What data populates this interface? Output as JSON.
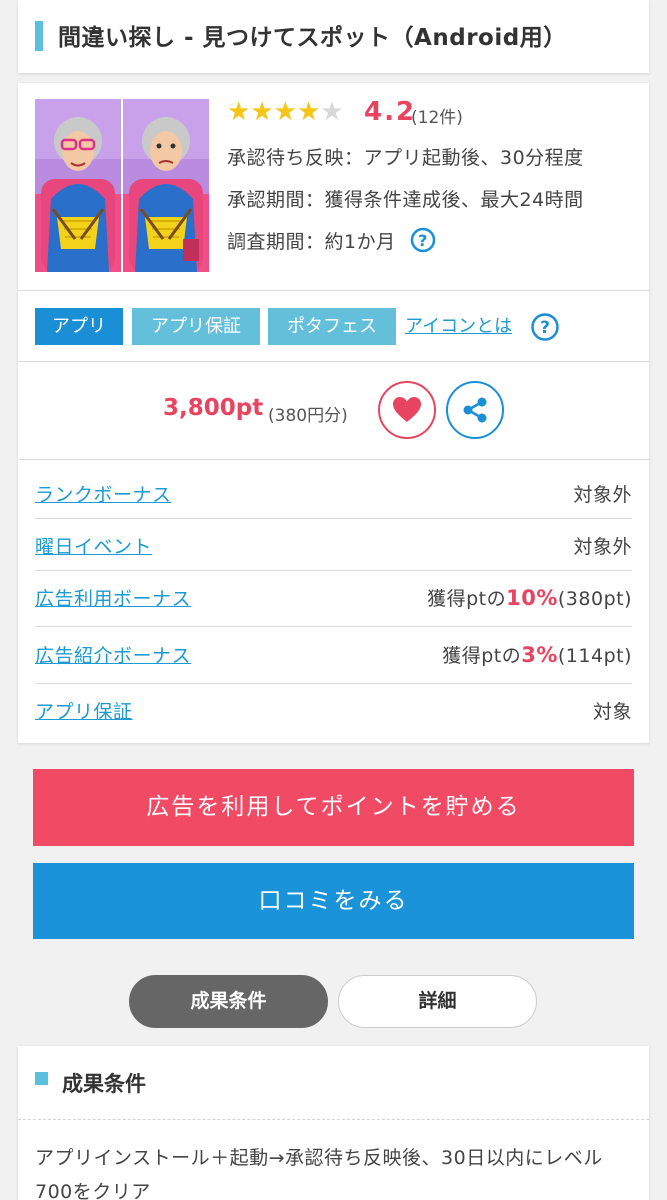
{
  "page": {
    "title": "間違い探し - 見つけてスポット（Android用）"
  },
  "offer": {
    "rating_value": "4.2",
    "rating_count": "(12件)",
    "rating_stars": 4.2,
    "approval_reflect": "承認待ち反映：アプリ起動後、30分程度",
    "approval_period": "承認期間：獲得条件達成後、最大24時間",
    "survey_period": "調査期間：約1か月",
    "tags": [
      "アプリ",
      "アプリ保証",
      "ポタフェス"
    ],
    "icon_link": "アイコンとは",
    "points": "3,800pt",
    "points_yen": "(380円分)"
  },
  "bonuses": [
    {
      "label": "ランクボーナス",
      "value_pre": "対象外",
      "value_pct": "",
      "value_post": ""
    },
    {
      "label": "曜日イベント",
      "value_pre": "対象外",
      "value_pct": "",
      "value_post": ""
    },
    {
      "label": "広告利用ボーナス",
      "value_pre": "獲得ptの",
      "value_pct": "10%",
      "value_post": "(380pt)"
    },
    {
      "label": "広告紹介ボーナス",
      "value_pre": "獲得ptの",
      "value_pct": "3%",
      "value_post": "(114pt)"
    },
    {
      "label": "アプリ保証",
      "value_pre": "対象",
      "value_pct": "",
      "value_post": ""
    }
  ],
  "actions": {
    "use_ad": "広告を利用してポイントを貯める",
    "reviews": "口コミをみる"
  },
  "segments": [
    "成果条件",
    "詳細"
  ],
  "conditions": {
    "title": "成果条件",
    "text": "アプリインストール＋起動→承認待ち反映後、30日以内にレベル700をクリア"
  },
  "colors": {
    "accent_red": "#e8435f",
    "accent_blue": "#1b8fd6",
    "tag_light_blue": "#64bfdb",
    "star": "#f5c518"
  }
}
